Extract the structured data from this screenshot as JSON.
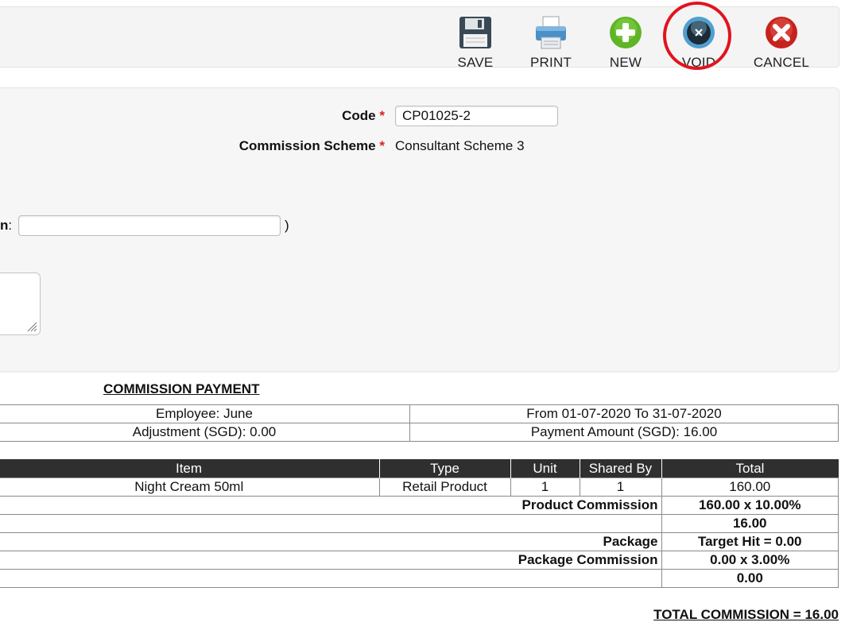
{
  "toolbar": {
    "save_label": "SAVE",
    "print_label": "PRINT",
    "new_label": "NEW",
    "void_label": "VOID",
    "cancel_label": "CANCEL"
  },
  "icons": {
    "save": "floppy-disk-icon",
    "print": "printer-icon",
    "new": "plus-circle-icon",
    "void": "void-circle-icon",
    "cancel": "x-circle-icon"
  },
  "colors": {
    "highlight_ring": "#e1141f",
    "required_star": "#d9231d",
    "new_green": "#5fb526",
    "cancel_red": "#c7221c",
    "header_dark": "#2f2f2f"
  },
  "form": {
    "code_label": "Code",
    "code_value": "CP01025-2",
    "scheme_label": "Commission Scheme",
    "scheme_value": "Consultant Scheme 3",
    "required_mark": "*",
    "partial_label": "n",
    "partial_colon": ":",
    "partial_input_value": "",
    "close_paren": ")"
  },
  "commission": {
    "title": "COMMISSION PAYMENT",
    "employee": "Employee: June",
    "period": "From 01-07-2020 To 31-07-2020",
    "adjustment": "Adjustment (SGD): 0.00",
    "payment_amount": "Payment Amount (SGD): 16.00",
    "columns": [
      "Item",
      "Type",
      "Unit",
      "Shared By",
      "Total"
    ],
    "item_row": {
      "item": "Night Cream 50ml",
      "type": "Retail Product",
      "unit": "1",
      "shared_by": "1",
      "total": "160.00"
    },
    "product_commission_label": "Product Commission",
    "product_commission_calc": "160.00 x 10.00%",
    "product_commission_total": "16.00",
    "package_label": "Package",
    "package_value": "Target Hit = 0.00",
    "package_commission_label": "Package Commission",
    "package_commission_calc": "0.00 x 3.00%",
    "package_commission_total": "0.00",
    "total_commission": "TOTAL COMMISSION = 16.00"
  }
}
